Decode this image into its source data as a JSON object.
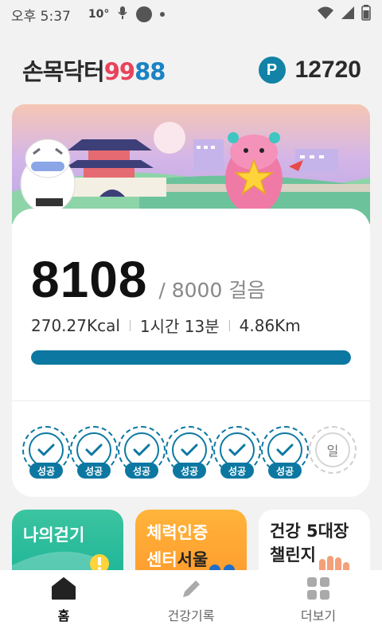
{
  "status_bar": {
    "time": "오후 5:37",
    "temp": "10°"
  },
  "header": {
    "logo_korean": "손목닥터",
    "logo_num1": "99",
    "logo_num2": "88",
    "points_badge": "P",
    "points": "12720"
  },
  "steps": {
    "count": "8108",
    "goal": "/ 8000 걸음",
    "progress": 1.0
  },
  "stats": {
    "kcal": "270.27Kcal",
    "time": "1시간 13분",
    "distance": "4.86Km"
  },
  "days": [
    {
      "status": "success",
      "label": "성공"
    },
    {
      "status": "success",
      "label": "성공"
    },
    {
      "status": "success",
      "label": "성공"
    },
    {
      "status": "success",
      "label": "성공"
    },
    {
      "status": "success",
      "label": "성공"
    },
    {
      "status": "success",
      "label": "성공"
    },
    {
      "status": "pending",
      "label": "일"
    }
  ],
  "tiles": {
    "walk": "나의걷기",
    "fitness_line1": "체력인증",
    "fitness_line2a": "센터",
    "fitness_line2b": "서울",
    "challenge_line1": "건강 5대장",
    "challenge_line2": "챌린지"
  },
  "nav": [
    {
      "label": "홈",
      "icon": "home-icon",
      "active": true
    },
    {
      "label": "건강기록",
      "icon": "pencil-icon",
      "active": false
    },
    {
      "label": "더보기",
      "icon": "grid-icon",
      "active": false
    }
  ],
  "colors": {
    "accent": "#0c78a2",
    "points_badge": "#1282a6",
    "walk_tile": "#1cb597",
    "fitness_tile": "#ff9b2e"
  }
}
